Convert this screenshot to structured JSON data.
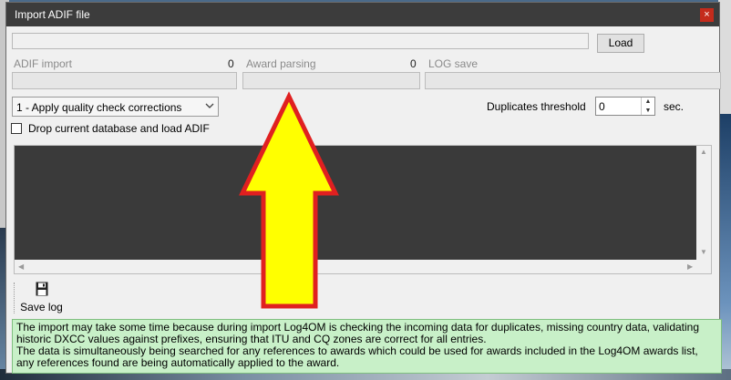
{
  "window": {
    "title": "Import ADIF file",
    "close_glyph": "×"
  },
  "file": {
    "path_value": "",
    "load_label": "Load"
  },
  "progress": [
    {
      "label": "ADIF import",
      "count": "0"
    },
    {
      "label": "Award parsing",
      "count": "0"
    },
    {
      "label": "LOG save",
      "count": ""
    }
  ],
  "options": {
    "mode_selected": "1 - Apply quality check corrections",
    "duplicates_label": "Duplicates threshold",
    "duplicates_value": "0",
    "duplicates_unit": "sec.",
    "drop_db_label": "Drop current database and load ADIF",
    "drop_db_checked": false
  },
  "toolbar": {
    "save_log_label": "Save log"
  },
  "info": {
    "line1": "The import may take some time because during  import Log4OM is checking the incoming data for duplicates, missing country data, validating historic DXCC values against prefixes, ensuring that ITU and CQ zones are correct for all entries.",
    "line2": "The data is simultaneously being searched for any references to awards which could be used for awards included in the Log4OM awards list, any references found are being automatically applied to the award."
  },
  "colors": {
    "titlebar": "#3c3c3c",
    "close": "#c42b1c",
    "log_bg": "#3a3a3a",
    "info_bg": "#c8f0c8",
    "arrow_fill": "#ffff00",
    "arrow_stroke": "#e02020"
  },
  "icons": {
    "close": "close-icon",
    "dropdown": "chevron-down-icon",
    "save": "floppy-disk-icon",
    "annotation": "up-arrow-annotation"
  }
}
